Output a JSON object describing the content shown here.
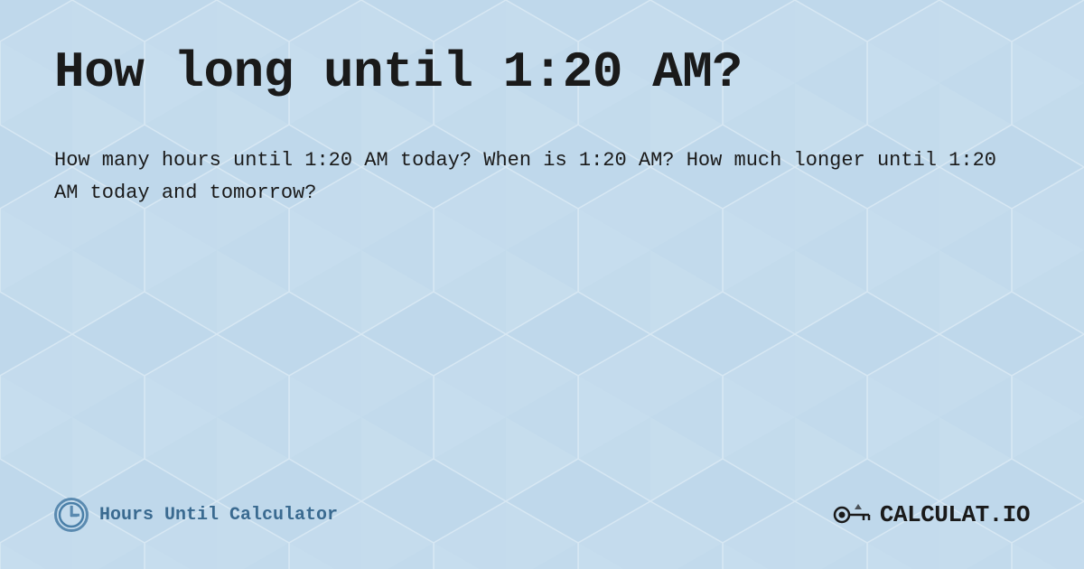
{
  "page": {
    "title": "How long until 1:20 AM?",
    "description": "How many hours until 1:20 AM today? When is 1:20 AM? How much longer until 1:20 AM today and tomorrow?",
    "background_color": "#c8dff0",
    "footer": {
      "brand_label": "Hours Until Calculator",
      "logo_text": "CALCULAT.IO"
    }
  }
}
